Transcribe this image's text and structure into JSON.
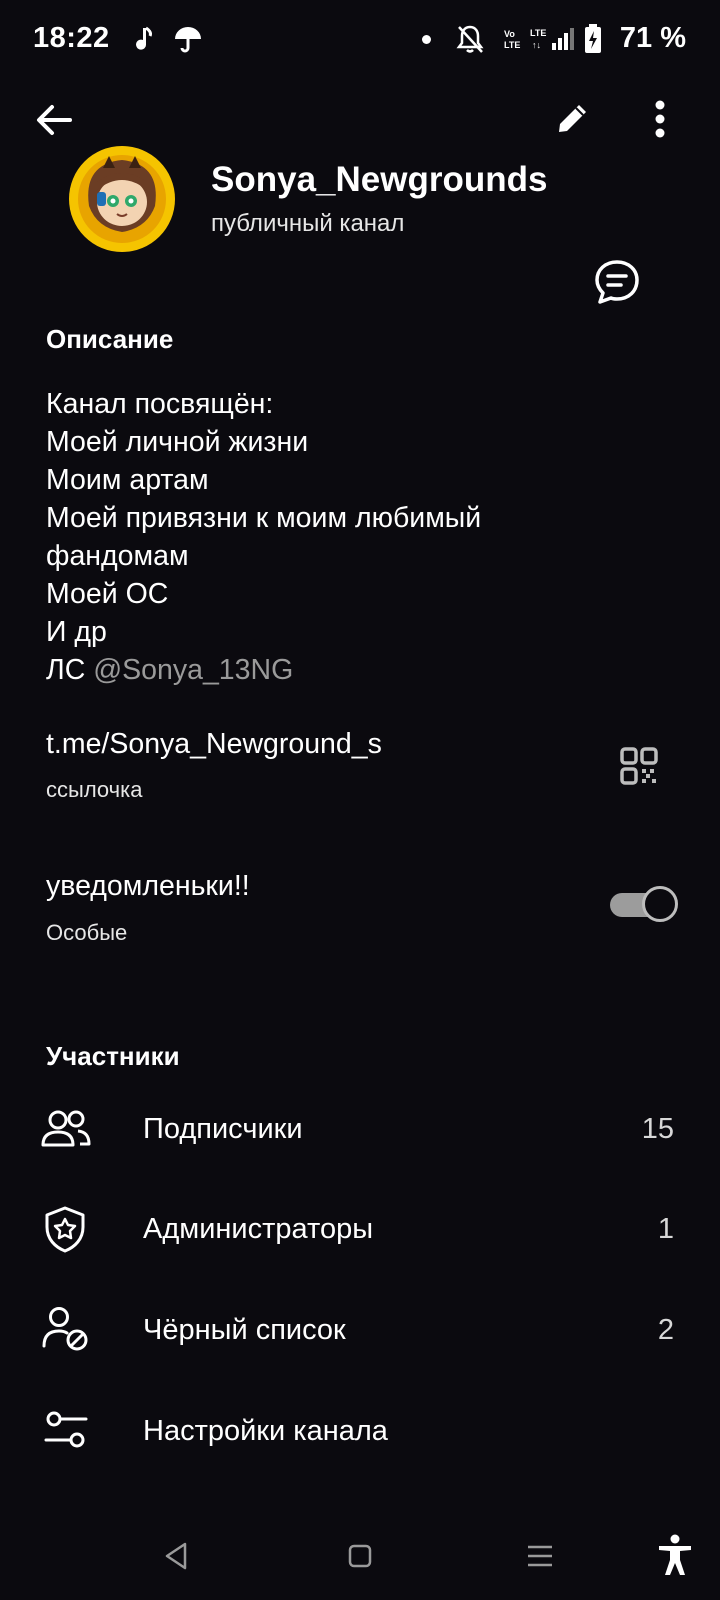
{
  "status_bar": {
    "time": "18:22",
    "battery_percent": "71 %",
    "icons": [
      "music-note-icon",
      "umbrella-icon",
      "dot-icon",
      "bell-off-icon",
      "volte-icon",
      "lte-signal-icon",
      "battery-charging-icon"
    ]
  },
  "header": {
    "channel_name": "Sonya_Newgrounds",
    "channel_type": "публичный канал"
  },
  "description": {
    "title": "Описание",
    "lines": [
      "Канал посвящён:",
      "Моей личной жизни",
      "Моим артам",
      "Моей привязни к моим любимый",
      "фандомам",
      "Моей ОС",
      "И др"
    ],
    "contact_prefix": "ЛС",
    "contact_handle": "@Sonya_13NG"
  },
  "link": {
    "value": "t.me/Sonya_Newground_s",
    "caption": "ссылочка"
  },
  "notifications": {
    "label": "уведомленьки!!",
    "caption": "Особые",
    "enabled": true
  },
  "members": {
    "title": "Участники",
    "items": [
      {
        "label": "Подписчики",
        "count": "15",
        "icon": "users-icon"
      },
      {
        "label": "Администраторы",
        "count": "1",
        "icon": "admin-shield-icon"
      },
      {
        "label": "Чёрный список",
        "count": "2",
        "icon": "user-block-icon"
      },
      {
        "label": "Настройки канала",
        "count": "",
        "icon": "settings-sliders-icon"
      }
    ]
  },
  "colors": {
    "background": "#0b0a0f",
    "text": "#ffffff",
    "muted": "#9a9a9a",
    "toggle": "#9c9c9c",
    "avatar_ring": "#f5c400"
  }
}
